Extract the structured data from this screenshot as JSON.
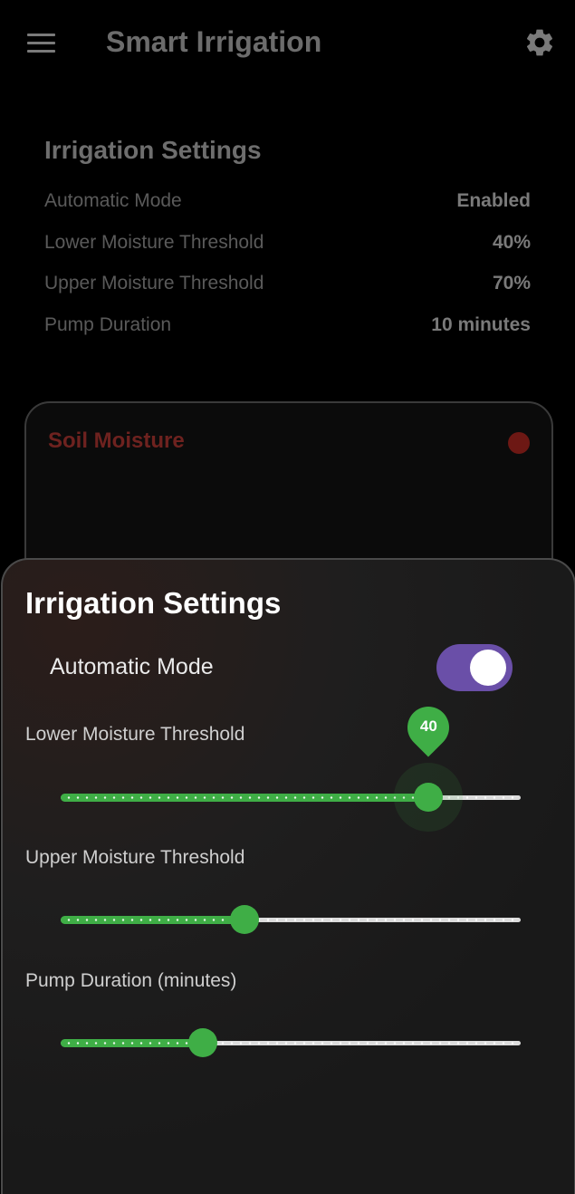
{
  "app_bar": {
    "title": "Smart Irrigation",
    "menu_icon": "hamburger-menu-icon",
    "settings_icon": "gear-icon"
  },
  "summary": {
    "title": "Irrigation Settings",
    "rows": [
      {
        "label": "Automatic Mode",
        "value": "Enabled"
      },
      {
        "label": "Lower Moisture Threshold",
        "value": "40%"
      },
      {
        "label": "Upper Moisture Threshold",
        "value": "70%"
      },
      {
        "label": "Pump Duration",
        "value": "10 minutes"
      }
    ]
  },
  "moisture_card": {
    "title": "Soil Moisture",
    "status_color": "#6d1814"
  },
  "sheet": {
    "title": "Irrigation Settings",
    "automatic_mode": {
      "label": "Automatic Mode",
      "enabled": true
    },
    "sliders": [
      {
        "label": "Lower Moisture Threshold",
        "fraction": 0.8,
        "bubble": "40"
      },
      {
        "label": "Upper Moisture Threshold",
        "fraction": 0.4
      },
      {
        "label": "Pump Duration (minutes)",
        "fraction": 0.31
      }
    ]
  },
  "colors": {
    "accent": "#3fae46",
    "toggle": "#6a4fa8",
    "background": "#000000"
  }
}
